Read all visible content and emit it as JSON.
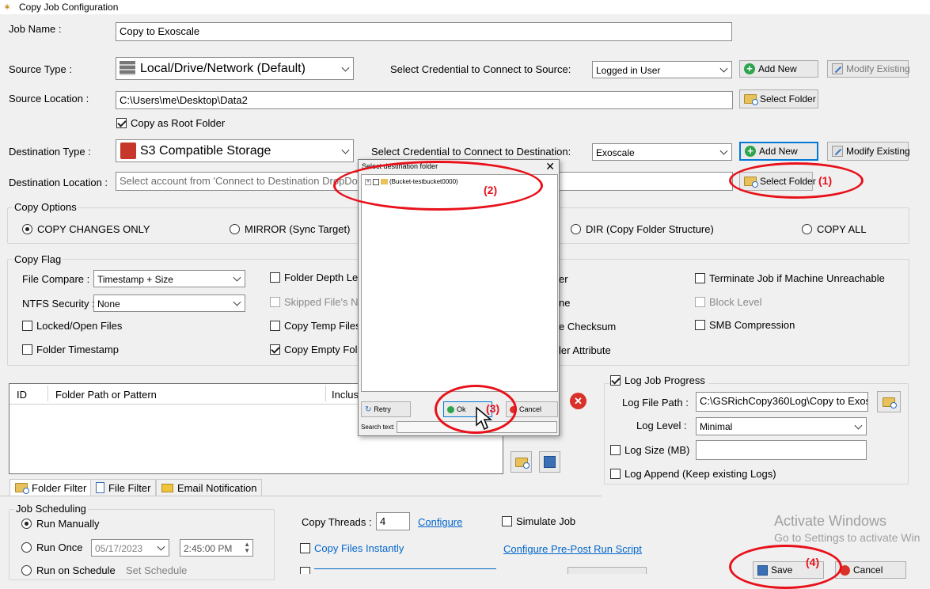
{
  "window": {
    "title": "Copy Job Configuration"
  },
  "job": {
    "name_label": "Job Name :",
    "name_value": "Copy to Exoscale"
  },
  "source": {
    "type_label": "Source Type :",
    "type_value": "Local/Drive/Network (Default)",
    "cred_label": "Select Credential to Connect to Source:",
    "cred_value": "Logged in User",
    "add_new": "Add New",
    "modify_existing": "Modify Existing",
    "location_label": "Source Location :",
    "location_value": "C:\\Users\\me\\Desktop\\Data2",
    "select_folder": "Select Folder",
    "copy_root": "Copy as Root Folder"
  },
  "destination": {
    "type_label": "Destination Type :",
    "type_value": "S3 Compatible Storage",
    "cred_label": "Select Credential to Connect to Destination:",
    "cred_value": "Exoscale",
    "add_new": "Add New",
    "modify_existing": "Modify Existing",
    "location_label": "Destination Location :",
    "location_value": "Select account from 'Connect to Destination DropDo",
    "select_folder": "Select Folder"
  },
  "copy_options": {
    "title": "Copy Options",
    "opt1": "COPY CHANGES ONLY",
    "opt2": "MIRROR (Sync Target)",
    "opt3": "DIR (Copy Folder Structure)",
    "opt4": "COPY ALL"
  },
  "copy_flag": {
    "title": "Copy Flag",
    "file_compare_label": "File Compare :",
    "file_compare_value": "Timestamp + Size",
    "ntfs_label": "NTFS Security :",
    "ntfs_value": "None",
    "locked_files": "Locked/Open Files",
    "folder_timestamp": "Folder Timestamp",
    "folder_depth": "Folder Depth Leve",
    "skipped_files": "Skipped File's N",
    "copy_temp": "Copy Temp Files",
    "copy_empty": "Copy Empty Fold",
    "col3_1": "er",
    "col3_2": "ne",
    "col3_3": "e Checksum",
    "col3_4": "ler Attribute",
    "terminate": "Terminate Job if Machine Unreachable",
    "block_level": "Block Level",
    "smb": "SMB Compression"
  },
  "table": {
    "col_id": "ID",
    "col_path": "Folder Path or Pattern",
    "col_incl": "Inclus"
  },
  "log": {
    "progress": "Log Job Progress",
    "file_path_label": "Log File Path :",
    "file_path_value": "C:\\GSRichCopy360Log\\Copy to Exos",
    "level_label": "Log Level :",
    "level_value": "Minimal",
    "size": "Log Size (MB)",
    "append": "Log Append (Keep existing Logs)"
  },
  "tabs": {
    "folder_filter": "Folder Filter",
    "file_filter": "File Filter",
    "email": "Email Notification"
  },
  "scheduling": {
    "title": "Job Scheduling",
    "manual": "Run Manually",
    "once": "Run Once",
    "on_schedule": "Run on Schedule",
    "set_schedule": "Set Schedule",
    "date": "05/17/2023",
    "time": "2:45:00 PM"
  },
  "bottom": {
    "threads_label": "Copy Threads :",
    "threads_value": "4",
    "configure": "Configure",
    "simulate": "Simulate Job",
    "copy_instantly": "Copy Files Instantly",
    "pre_post": "Configure Pre-Post Run Script",
    "save": "Save",
    "cancel": "Cancel"
  },
  "dialog": {
    "title": "Select destination folder",
    "node": "(Bucket-testbucket0000)",
    "retry": "Retry",
    "ok": "Ok",
    "cancel": "Cancel",
    "search_label": "Search text:"
  },
  "annotations": {
    "n1": "(1)",
    "n2": "(2)",
    "n3": "(3)",
    "n4": "(4)"
  },
  "watermark": {
    "line1": "Activate Windows",
    "line2": "Go to Settings to activate Win"
  },
  "colors": {
    "annotation_red": "#e8111a",
    "link_blue": "#0066cc",
    "focus_blue": "#0078d7"
  }
}
